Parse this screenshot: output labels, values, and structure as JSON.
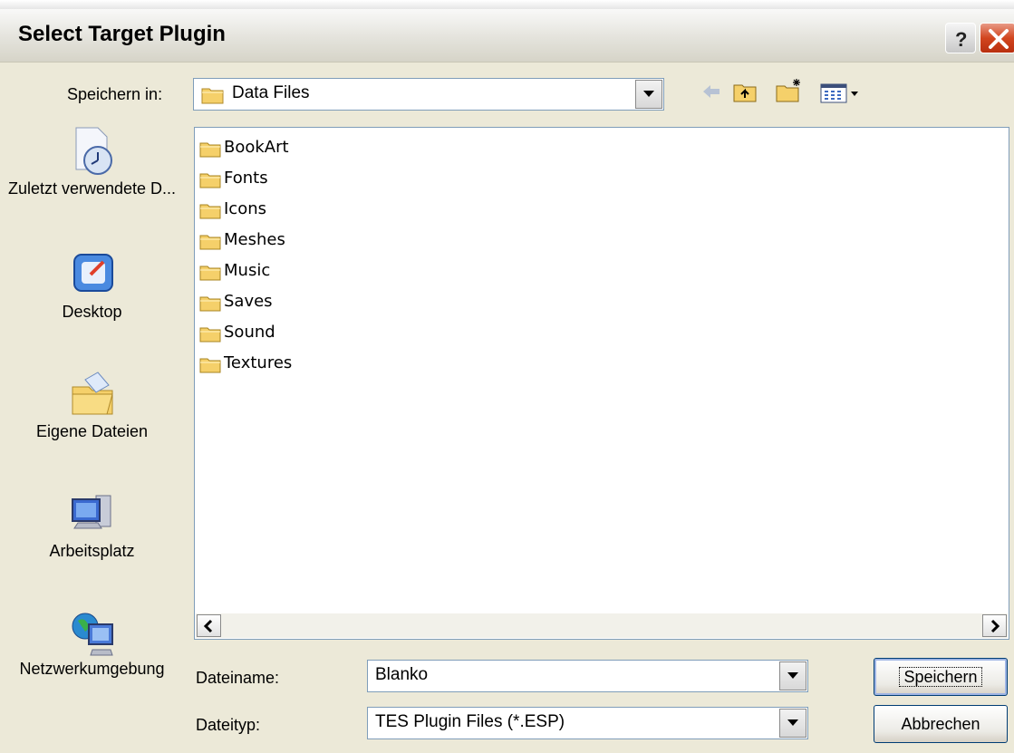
{
  "window": {
    "title": "Select Target Plugin"
  },
  "toolbar": {
    "save_in_label": "Speichern in:",
    "save_in_value": "Data Files",
    "tools": [
      "back-icon",
      "up-folder-icon",
      "new-folder-icon",
      "view-menu-icon"
    ]
  },
  "places": [
    {
      "label": "Zuletzt verwendete D...",
      "icon": "recent-documents-icon"
    },
    {
      "label": "Desktop",
      "icon": "desktop-icon"
    },
    {
      "label": "Eigene Dateien",
      "icon": "my-documents-icon"
    },
    {
      "label": "Arbeitsplatz",
      "icon": "my-computer-icon"
    },
    {
      "label": "Netzwerkumgebung",
      "icon": "network-icon"
    }
  ],
  "files": [
    "BookArt",
    "Fonts",
    "Icons",
    "Meshes",
    "Music",
    "Saves",
    "Sound",
    "Textures"
  ],
  "filename": {
    "label": "Dateiname:",
    "value": "Blanko"
  },
  "filetype": {
    "label": "Dateityp:",
    "value": "TES Plugin Files (*.ESP)"
  },
  "buttons": {
    "save": "Speichern",
    "cancel": "Abbrechen"
  },
  "colors": {
    "titlebar": "#e4e3dc",
    "dialog_bg": "#ece9d8",
    "close": "#d2451e",
    "folder": "#f5d06a"
  }
}
